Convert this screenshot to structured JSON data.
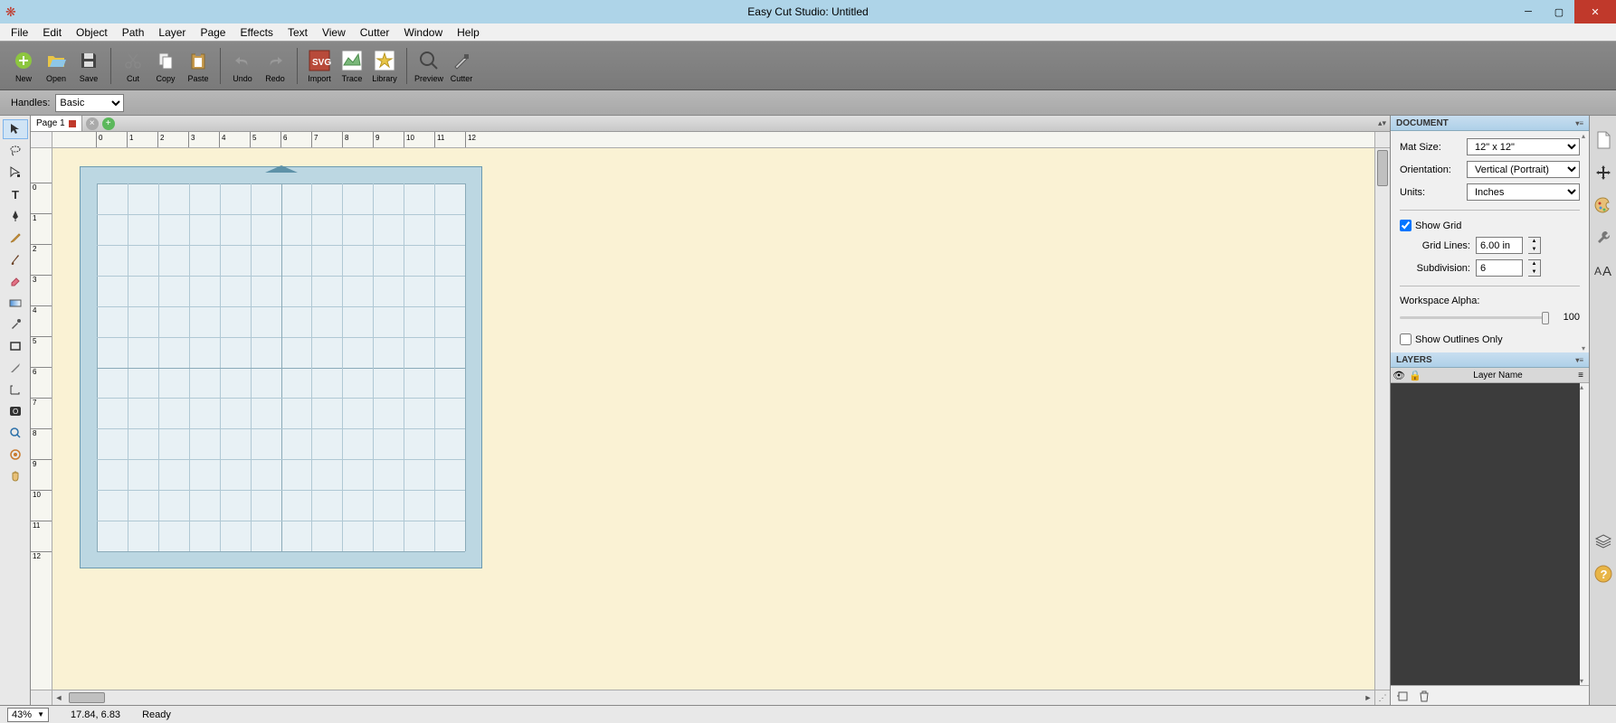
{
  "window": {
    "title": "Easy Cut Studio: Untitled"
  },
  "menu": {
    "items": [
      "File",
      "Edit",
      "Object",
      "Path",
      "Layer",
      "Page",
      "Effects",
      "Text",
      "View",
      "Cutter",
      "Window",
      "Help"
    ]
  },
  "toolbar": {
    "buttons": [
      {
        "label": "New",
        "icon": "new"
      },
      {
        "label": "Open",
        "icon": "open"
      },
      {
        "label": "Save",
        "icon": "save"
      },
      {
        "sep": true
      },
      {
        "label": "Cut",
        "icon": "cut"
      },
      {
        "label": "Copy",
        "icon": "copy"
      },
      {
        "label": "Paste",
        "icon": "paste"
      },
      {
        "sep": true
      },
      {
        "label": "Undo",
        "icon": "undo"
      },
      {
        "label": "Redo",
        "icon": "redo"
      },
      {
        "sep": true
      },
      {
        "label": "Import",
        "icon": "import"
      },
      {
        "label": "Trace",
        "icon": "trace"
      },
      {
        "label": "Library",
        "icon": "library"
      },
      {
        "sep": true
      },
      {
        "label": "Preview",
        "icon": "preview"
      },
      {
        "label": "Cutter",
        "icon": "cutter"
      }
    ]
  },
  "options": {
    "handles_label": "Handles:",
    "handles_value": "Basic"
  },
  "page_tab": {
    "label": "Page 1"
  },
  "ruler": {
    "h_ticks": [
      "0",
      "1",
      "2",
      "3",
      "4",
      "5",
      "6",
      "7",
      "8",
      "9",
      "10",
      "11",
      "12"
    ],
    "v_ticks": [
      "0",
      "1",
      "2",
      "3",
      "4",
      "5",
      "6",
      "7",
      "8",
      "9",
      "10",
      "11",
      "12"
    ]
  },
  "right": {
    "doc_header": "DOCUMENT",
    "mat_label": "Mat Size:",
    "mat_value": "12\" x 12\"",
    "orient_label": "Orientation:",
    "orient_value": "Vertical (Portrait)",
    "units_label": "Units:",
    "units_value": "Inches",
    "show_grid_label": "Show Grid",
    "gridlines_label": "Grid Lines:",
    "gridlines_value": "6.00 in",
    "subdiv_label": "Subdivision:",
    "subdiv_value": "6",
    "workspace_alpha_label": "Workspace Alpha:",
    "workspace_alpha_value": "100",
    "show_outlines_label": "Show Outlines Only",
    "layers_header": "LAYERS",
    "layers_col_name": "Layer Name"
  },
  "status": {
    "zoom": "43%",
    "coords": "17.84, 6.83",
    "state": "Ready"
  }
}
